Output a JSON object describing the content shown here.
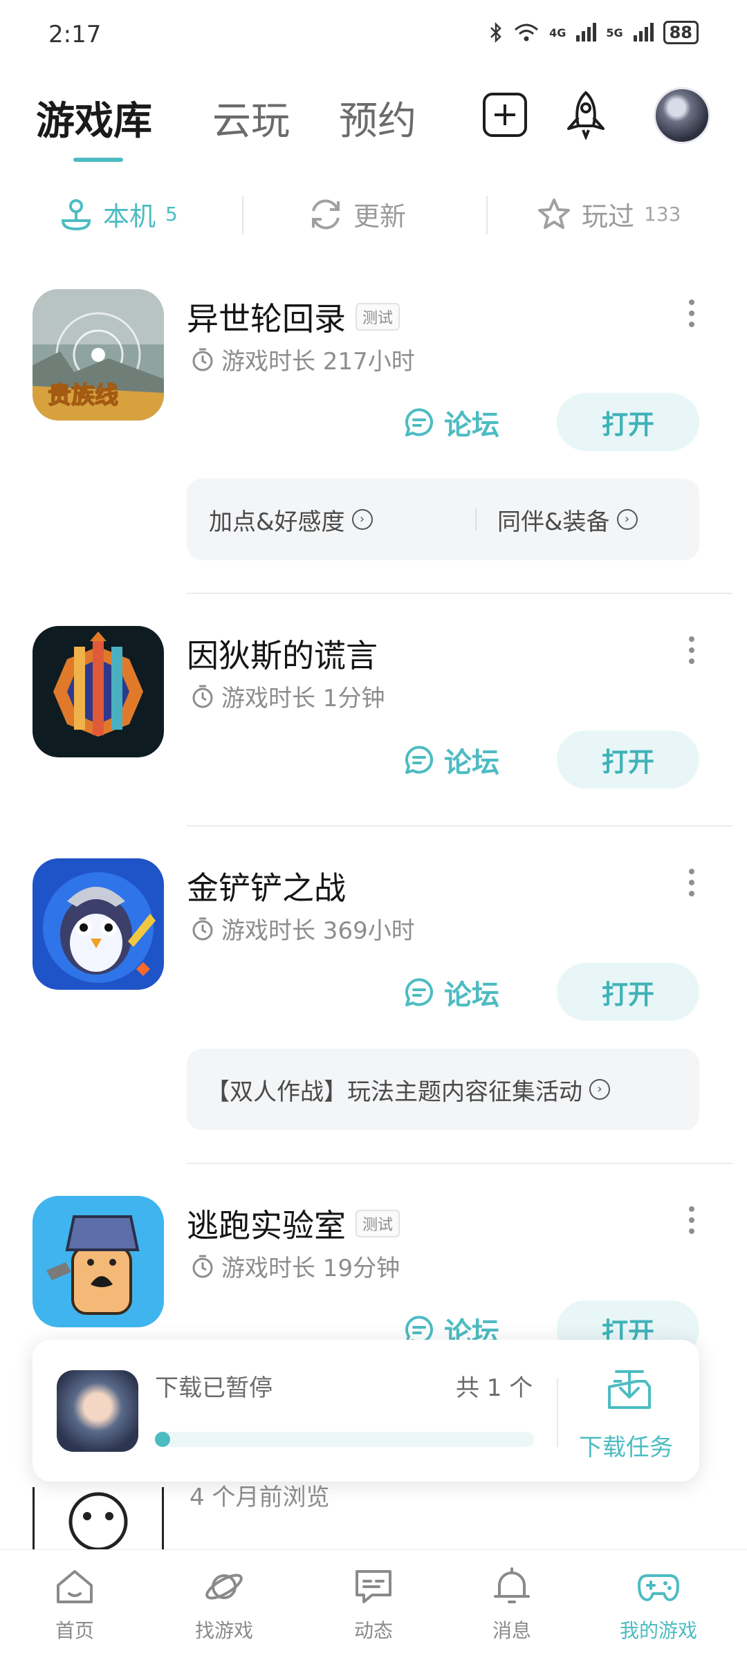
{
  "status_bar": {
    "time": "2:17",
    "network_1": "4G",
    "network_2": "5G",
    "battery": "88"
  },
  "header": {
    "tabs": [
      {
        "label": "游戏库"
      },
      {
        "label": "云玩"
      },
      {
        "label": "预约"
      }
    ]
  },
  "sub_tabs": [
    {
      "label": "本机",
      "count": "5",
      "icon": "joystick-icon"
    },
    {
      "label": "更新",
      "count": "",
      "icon": "refresh-icon"
    },
    {
      "label": "玩过",
      "count": "133",
      "icon": "star-icon"
    }
  ],
  "games": [
    {
      "title": "异世轮回录",
      "tag": "测试",
      "playtime": "游戏时长 217小时",
      "forum": "论坛",
      "open": "打开",
      "icon_text": "贵族线",
      "links": [
        "加点&好感度",
        "同伴&装备"
      ]
    },
    {
      "title": "因狄斯的谎言",
      "tag": "",
      "playtime": "游戏时长 1分钟",
      "forum": "论坛",
      "open": "打开",
      "links": []
    },
    {
      "title": "金铲铲之战",
      "tag": "",
      "playtime": "游戏时长 369小时",
      "forum": "论坛",
      "open": "打开",
      "links": [
        "【双人作战】玩法主题内容征集活动"
      ]
    },
    {
      "title": "逃跑实验室",
      "tag": "测试",
      "playtime": "游戏时长 19分钟",
      "forum": "论坛",
      "open": "打开",
      "links": []
    }
  ],
  "partial_row": {
    "text": "4 个月前浏览"
  },
  "download": {
    "status": "下载已暂停",
    "count": "共 1 个",
    "progress": 0.01,
    "task_label": "下载任务"
  },
  "bottom_nav": [
    {
      "label": "首页",
      "icon": "home-icon"
    },
    {
      "label": "找游戏",
      "icon": "planet-icon"
    },
    {
      "label": "动态",
      "icon": "chat-icon"
    },
    {
      "label": "消息",
      "icon": "bell-icon"
    },
    {
      "label": "我的游戏",
      "icon": "gamepad-icon"
    }
  ],
  "colors": {
    "accent": "#4cbcc2",
    "button_bg": "#e8f6f7",
    "panel_bg": "#f4f5f7"
  }
}
